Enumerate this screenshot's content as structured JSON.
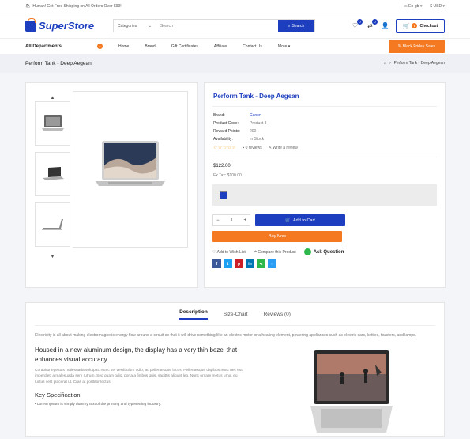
{
  "topbar": {
    "promo": "Hurrah! Get Free Shipping on All Orders Over $99!",
    "language": "En-gb",
    "currency": "$ USD"
  },
  "header": {
    "logo": "SuperStore",
    "categories": "Categories",
    "search_placeholder": "Search",
    "search_btn": "Search",
    "wishlist_count": "0",
    "compare_count": "0",
    "cart_count": "0",
    "checkout": "Checkout"
  },
  "nav": {
    "all_departments": "All Departments",
    "items": [
      "Home",
      "Brand",
      "Gift Certificates",
      "Affiliate",
      "Contact Us",
      "More"
    ],
    "promo_btn": "% Black Friday Sales"
  },
  "breadcrumb": {
    "page_title": "Perform Tank - Deep Aegean",
    "current": "Perform Tank - Deep Aegean"
  },
  "product": {
    "title": "Perform Tank - Deep Aegean",
    "specs": [
      {
        "k": "Brand:",
        "v": "Canon"
      },
      {
        "k": "Product Code:",
        "v": "Product 3"
      },
      {
        "k": "Reward Points:",
        "v": "200"
      },
      {
        "k": "Availability:",
        "v": "In Stock"
      }
    ],
    "rating_stars": "☆☆☆☆☆",
    "reviews": "0 reviews",
    "write_review": "Write a review",
    "price": "$122.00",
    "ex_tax": "Ex Tax: $100.00",
    "qty": "1",
    "add_to_cart": "Add to Cart",
    "buy_now": "Buy Now",
    "add_wishlist": "Add to Wish List",
    "compare": "Compare this Product",
    "ask": "Ask Question",
    "share_colors": [
      "#3b5998",
      "#1da1f2",
      "#cb2027",
      "#0077b5",
      "#2eb84b",
      "#2a9df4"
    ]
  },
  "description": {
    "tabs": [
      "Description",
      "Size-Chart",
      "Reviews (0)"
    ],
    "intro": "Electricity is all about making electromagnetic energy flow around a circuit so that it will drive something like an electric motor or a heating element, powering appliances such as electric cars, kettles, toasters, and lamps.",
    "heading": "Housed in a new aluminum design, the display has a very thin bezel that enhances visual accuracy.",
    "para": "Curabitur egestas malesuada volutpat. Nunc vel vestibulum odio, ac pellentesque lacus. Pellentesque dapibus nunc nec est imperdiet, a malesuada sem rutrum. Sed quam odio, porta a finibus quis, sagittis aliquet leo. Nunc ornare metus urna, eu luctus velit placerat ut. Cras at porttitor lectus.",
    "key_spec": "Key Specification",
    "li1": "• Lorem Ipsum is simply dummy text of the printing and typesetting industry."
  }
}
